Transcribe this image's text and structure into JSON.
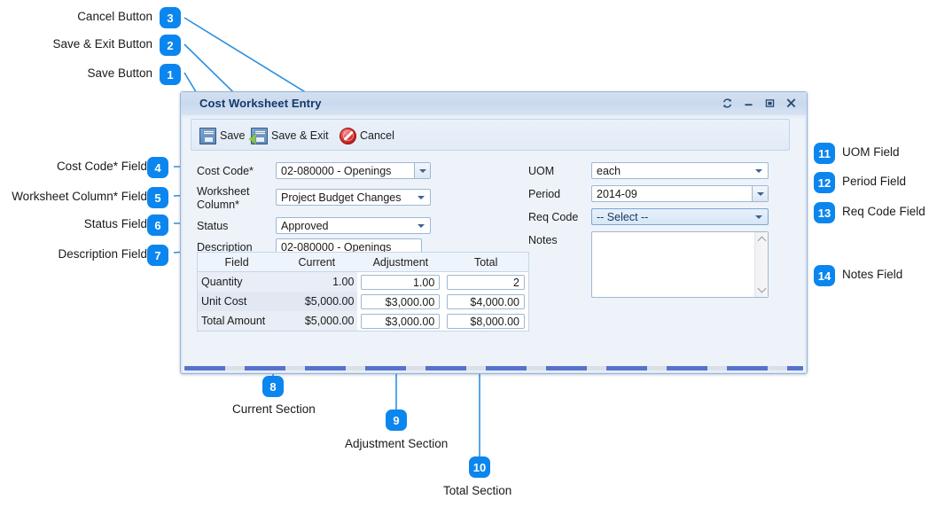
{
  "window": {
    "title": "Cost Worksheet Entry",
    "controls": {
      "refresh": "refresh-icon",
      "minimize": "minimize-icon",
      "maximize": "maximize-icon",
      "close": "close-icon"
    }
  },
  "toolbar": {
    "save_label": "Save",
    "save_exit_label": "Save & Exit",
    "cancel_label": "Cancel"
  },
  "form": {
    "left": {
      "cost_code_label": "Cost Code*",
      "cost_code_value": "02-080000 - Openings",
      "worksheet_column_label_line1": "Worksheet",
      "worksheet_column_label_line2": "Column*",
      "worksheet_column_value": "Project Budget Changes",
      "status_label": "Status",
      "status_value": "Approved",
      "description_label": "Description",
      "description_value": "02-080000 - Openings"
    },
    "right": {
      "uom_label": "UOM",
      "uom_value": "each",
      "period_label": "Period",
      "period_value": "2014-09",
      "req_code_label": "Req Code",
      "req_code_value": "-- Select --",
      "notes_label": "Notes",
      "notes_value": ""
    }
  },
  "grid": {
    "headers": [
      "Field",
      "Current",
      "Adjustment",
      "Total"
    ],
    "rows": [
      {
        "field": "Quantity",
        "current": "1.00",
        "adjustment": "1.00",
        "total": "2"
      },
      {
        "field": "Unit Cost",
        "current": "$5,000.00",
        "adjustment": "$3,000.00",
        "total": "$4,000.00"
      },
      {
        "field": "Total Amount",
        "current": "$5,000.00",
        "adjustment": "$3,000.00",
        "total": "$8,000.00"
      }
    ]
  },
  "annotations": [
    {
      "num": "1",
      "label": "Save Button"
    },
    {
      "num": "2",
      "label": "Save & Exit Button"
    },
    {
      "num": "3",
      "label": "Cancel Button"
    },
    {
      "num": "4",
      "label": "Cost Code* Field"
    },
    {
      "num": "5",
      "label": "Worksheet Column* Field"
    },
    {
      "num": "6",
      "label": "Status Field"
    },
    {
      "num": "7",
      "label": "Description Field"
    },
    {
      "num": "8",
      "label": "Current Section"
    },
    {
      "num": "9",
      "label": "Adjustment Section"
    },
    {
      "num": "10",
      "label": "Total Section"
    },
    {
      "num": "11",
      "label": "UOM Field"
    },
    {
      "num": "12",
      "label": "Period Field"
    },
    {
      "num": "13",
      "label": "Req Code Field"
    },
    {
      "num": "14",
      "label": "Notes Field"
    }
  ],
  "colors": {
    "badge_blue": "#0b86ee",
    "leader_blue": "#2a8fe0",
    "title_text": "#14396b",
    "window_bg": "#eef3fa"
  }
}
